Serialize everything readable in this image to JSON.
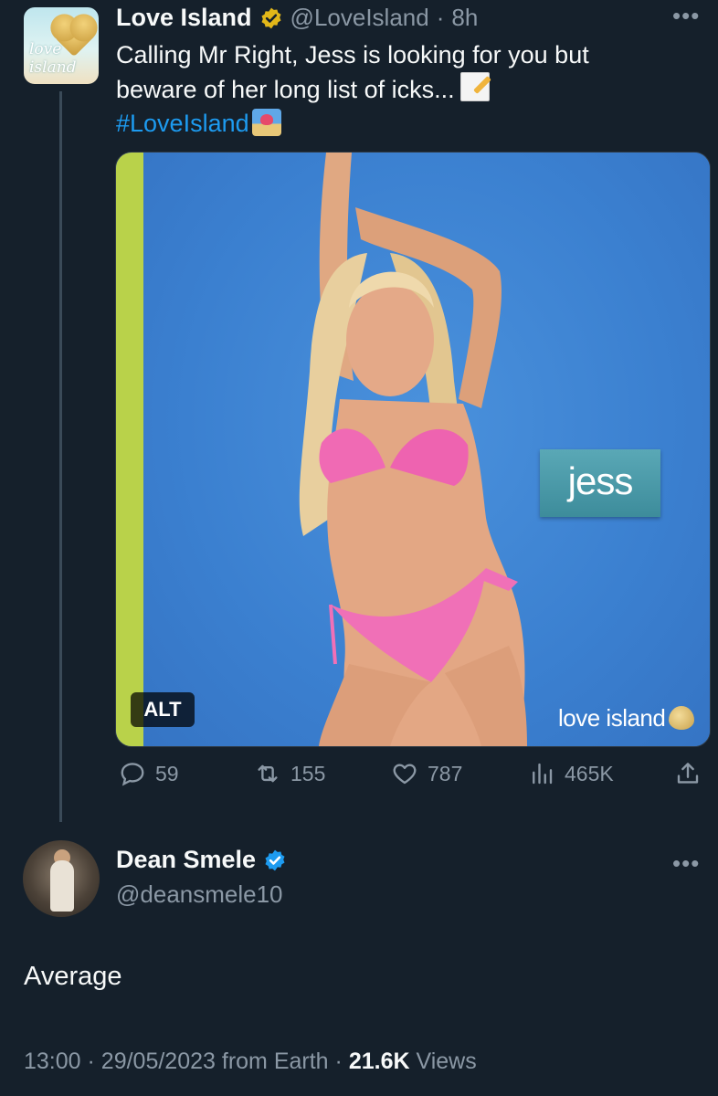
{
  "original_tweet": {
    "author_name": "Love Island",
    "handle": "@LoveIsland",
    "time": "8h",
    "separator": "·",
    "avatar_text": "love island",
    "text_line1": "Calling Mr Right, Jess is looking for you but",
    "text_line2": "beware of her long list of icks...",
    "hashtag": "#LoveIsland",
    "more_icon": "more-dots-icon",
    "verified_badge": "gold-verified-badge",
    "image": {
      "name_card": "jess",
      "alt_badge": "ALT",
      "logo_text": "love island"
    },
    "actions": {
      "replies": "59",
      "retweets": "155",
      "likes": "787",
      "views": "465K"
    }
  },
  "reply": {
    "author_name": "Dean Smele",
    "handle": "@deansmele10",
    "verified_badge": "blue-verified-badge",
    "text": "Average",
    "time": "13:00",
    "date": "29/05/2023",
    "source": "from Earth",
    "views_count": "21.6K",
    "views_label": "Views"
  },
  "colors": {
    "background": "#15202b",
    "text": "#f7f9f9",
    "muted": "#8b98a5",
    "link": "#1d9bf0",
    "gold_badge": "#e2b719",
    "blue_badge": "#1d9bf0"
  }
}
